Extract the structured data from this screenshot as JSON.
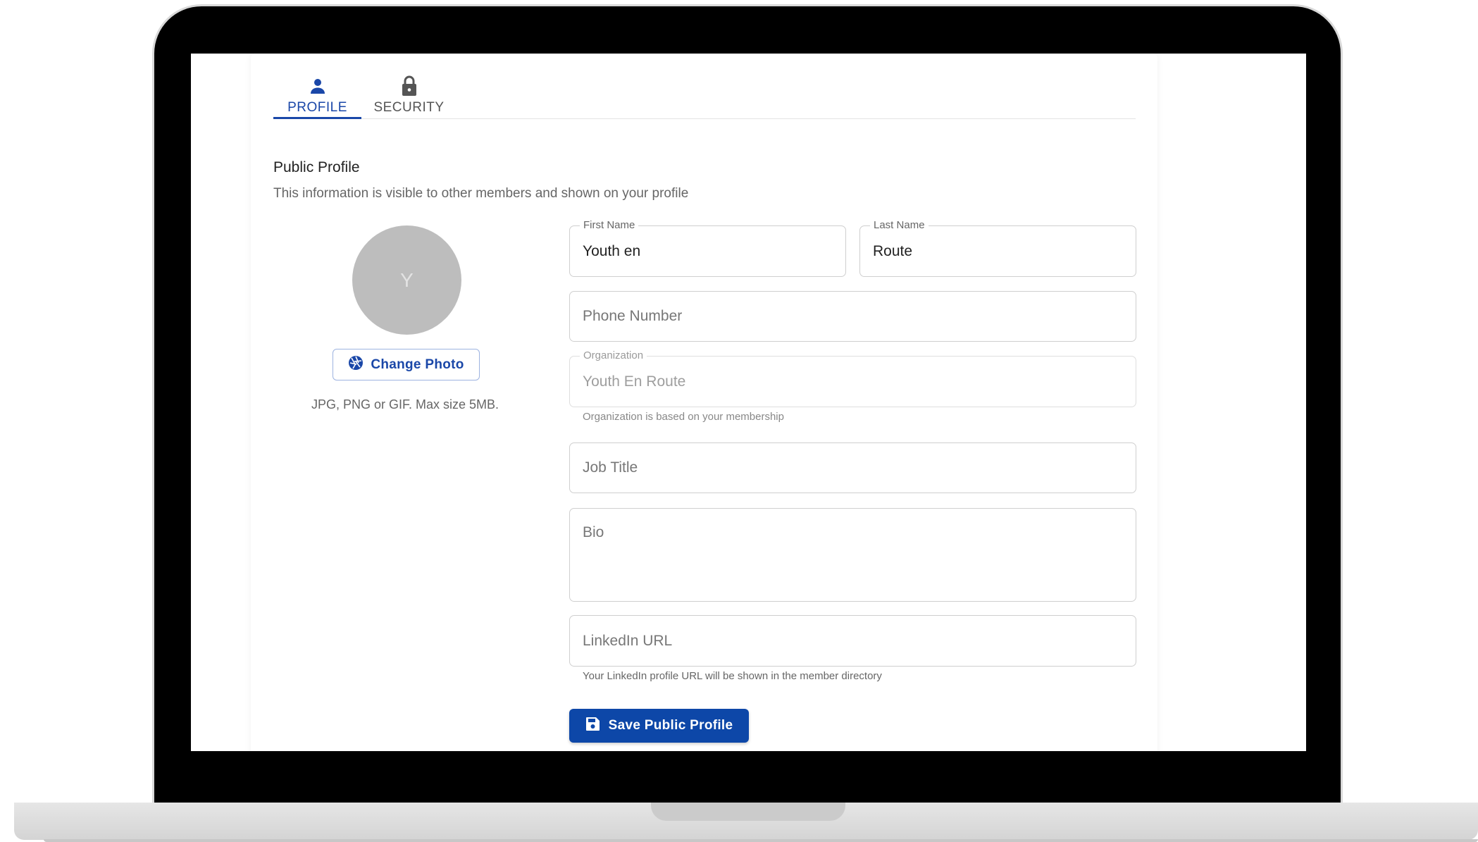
{
  "tabs": [
    {
      "label": "PROFILE",
      "icon": "person-icon",
      "active": true
    },
    {
      "label": "SECURITY",
      "icon": "lock-icon",
      "active": false
    }
  ],
  "section": {
    "title": "Public Profile",
    "description": "This information is visible to other members and shown on your profile"
  },
  "avatar": {
    "initial": "Y",
    "change_photo_label": "Change Photo",
    "hint": "JPG, PNG or GIF. Max size 5MB."
  },
  "fields": {
    "first_name": {
      "label": "First Name",
      "value": "Youth en"
    },
    "last_name": {
      "label": "Last Name",
      "value": "Route"
    },
    "phone": {
      "placeholder": "Phone Number"
    },
    "organization": {
      "label": "Organization",
      "value": "Youth En Route",
      "helper": "Organization is based on your membership"
    },
    "job_title": {
      "placeholder": "Job Title"
    },
    "bio": {
      "placeholder": "Bio"
    },
    "linkedin": {
      "placeholder": "LinkedIn URL",
      "helper": "Your LinkedIn profile URL will be shown in the member directory"
    }
  },
  "save_button": {
    "label": "Save Public Profile",
    "icon": "save-icon"
  },
  "colors": {
    "accent": "#1a47a8",
    "button": "#0d47a8",
    "avatar": "#bdbdbd"
  }
}
